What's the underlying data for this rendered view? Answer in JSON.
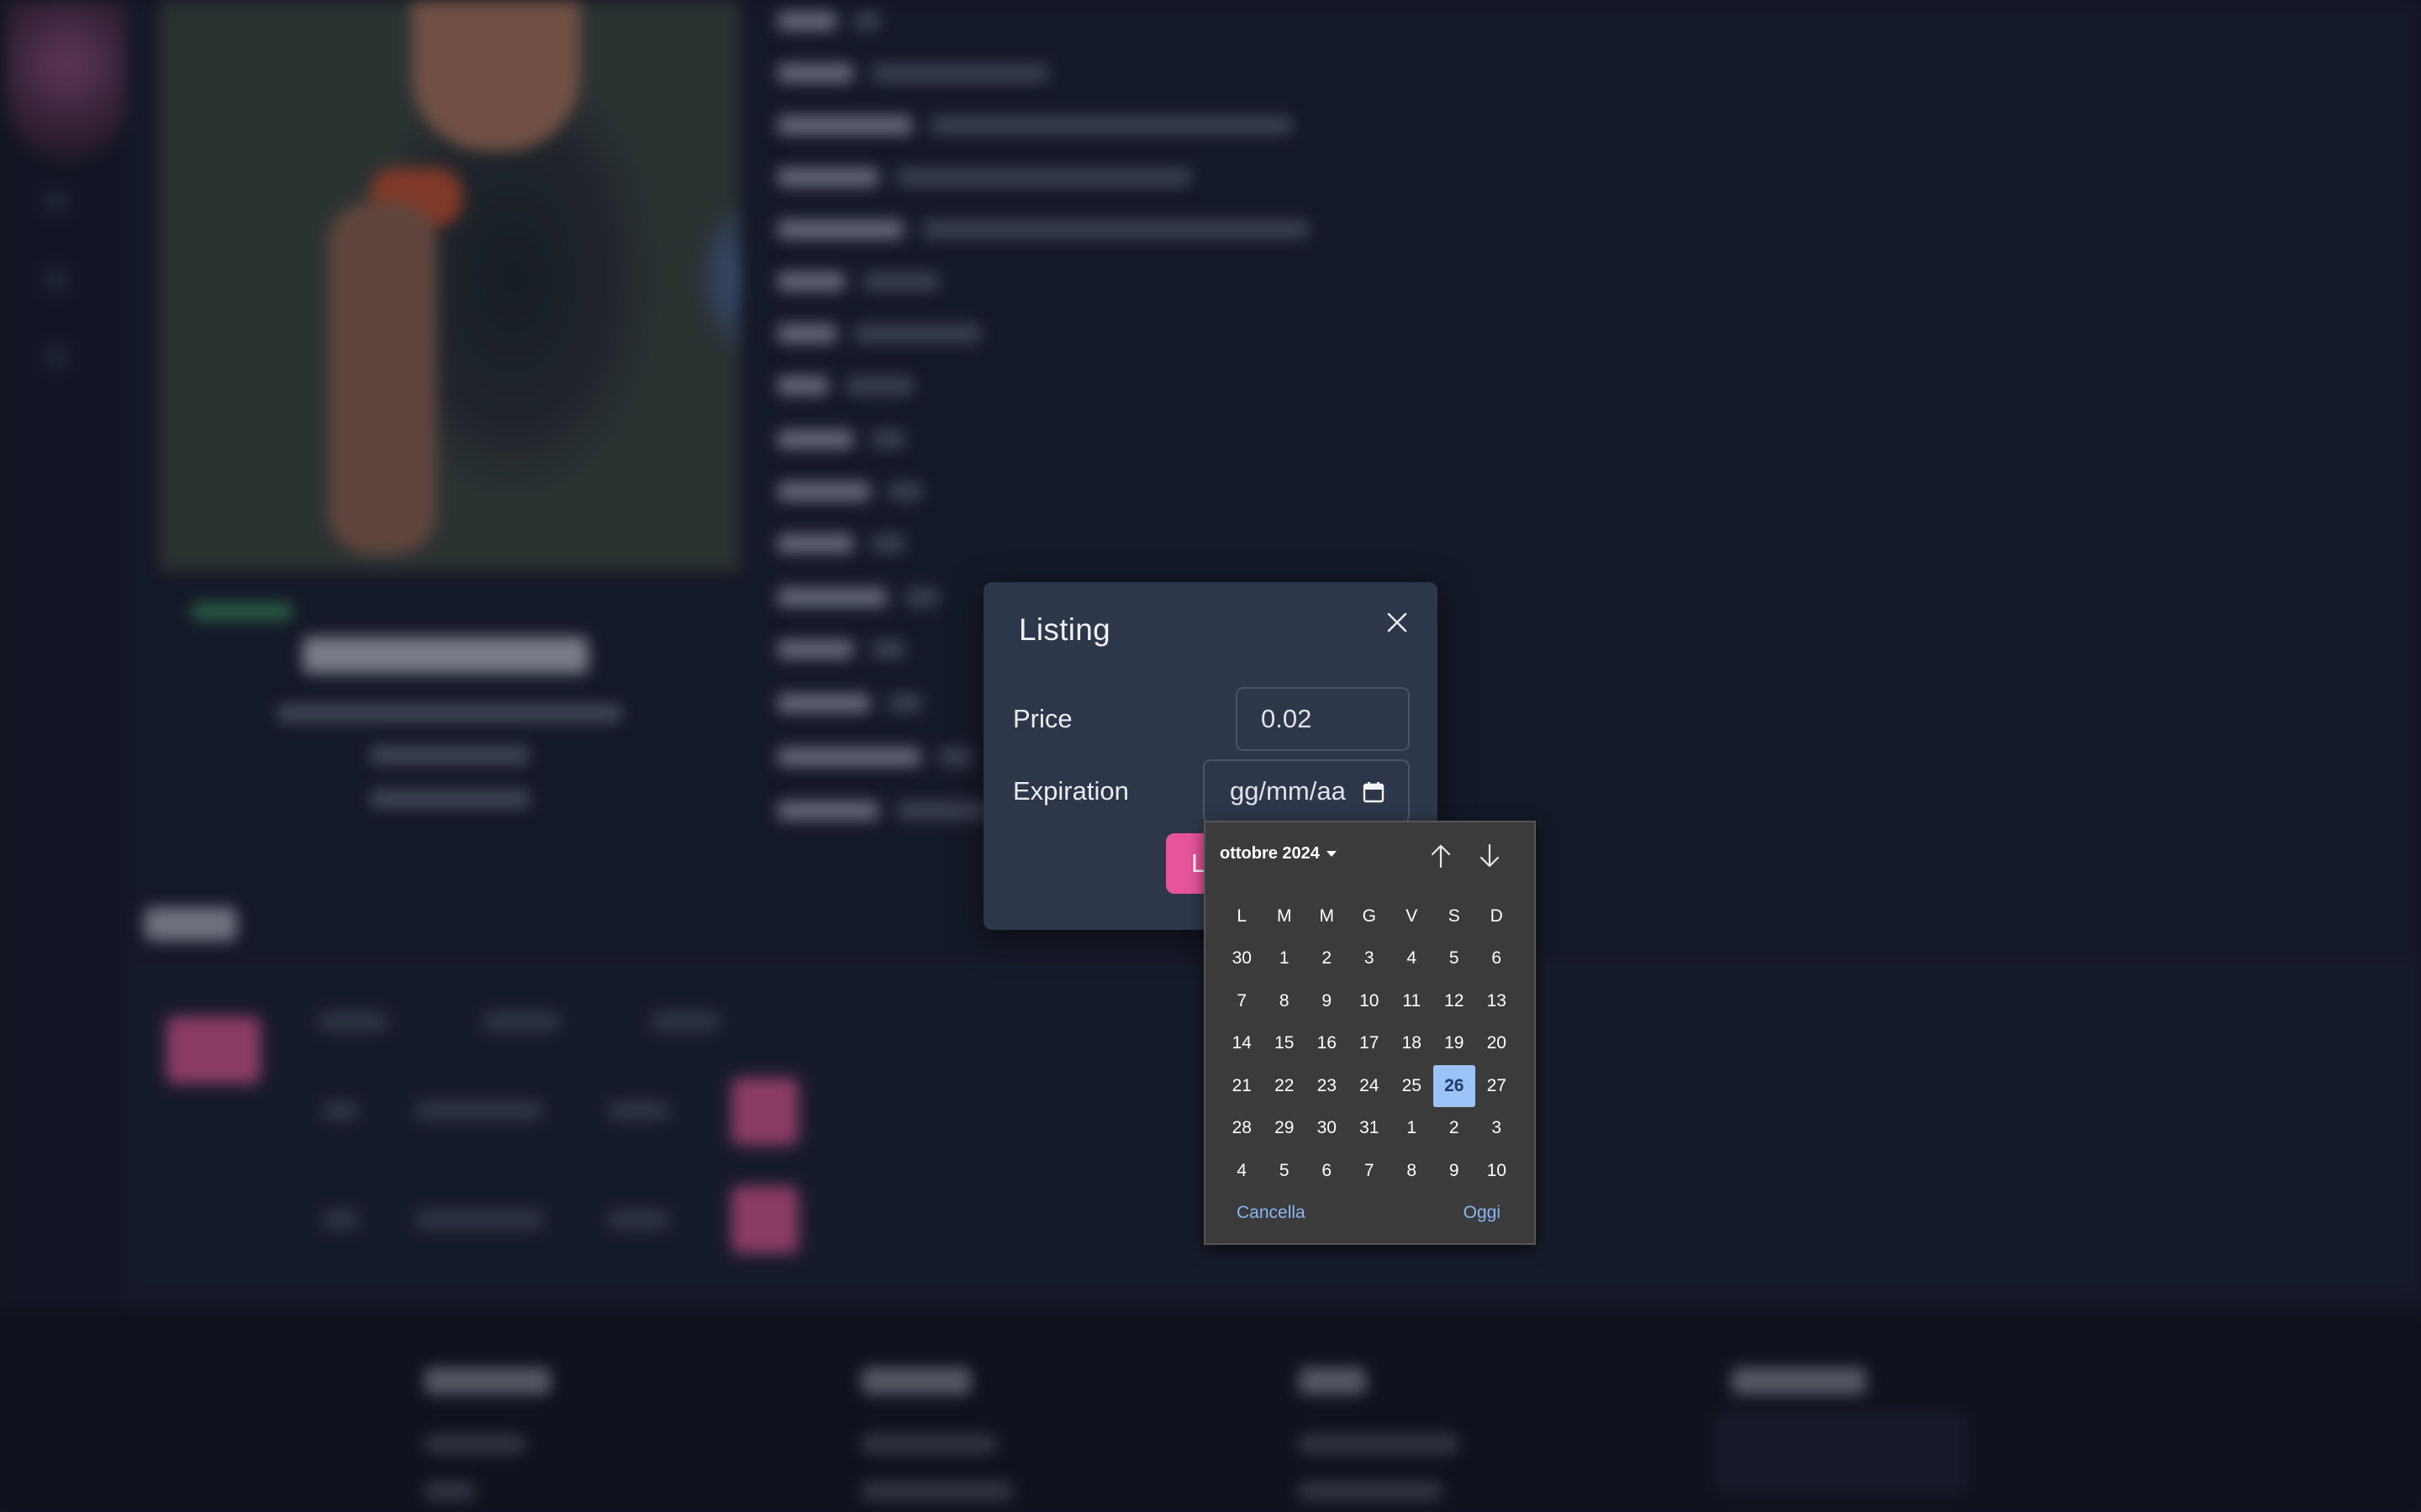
{
  "modal": {
    "title": "Listing",
    "price_label": "Price",
    "price_value": "0.02",
    "expiration_label": "Expiration",
    "expiration_placeholder": "gg/mm/aa",
    "submit_label": "L"
  },
  "datepicker": {
    "month_label": "ottobre 2024",
    "weekdays": [
      "L",
      "M",
      "M",
      "G",
      "V",
      "S",
      "D"
    ],
    "weeks": [
      [
        "30",
        "1",
        "2",
        "3",
        "4",
        "5",
        "6"
      ],
      [
        "7",
        "8",
        "9",
        "10",
        "11",
        "12",
        "13"
      ],
      [
        "14",
        "15",
        "16",
        "17",
        "18",
        "19",
        "20"
      ],
      [
        "21",
        "22",
        "23",
        "24",
        "25",
        "26",
        "27"
      ],
      [
        "28",
        "29",
        "30",
        "31",
        "1",
        "2",
        "3"
      ],
      [
        "4",
        "5",
        "6",
        "7",
        "8",
        "9",
        "10"
      ]
    ],
    "selected_day": "26",
    "cancel_label": "Cancella",
    "today_label": "Oggi"
  },
  "colors": {
    "accent": "#e6559b",
    "modal_bg": "#2e3749",
    "picker_bg": "#3b3b3b",
    "today_highlight": "#9bc3f7",
    "link": "#8ab6f5"
  }
}
